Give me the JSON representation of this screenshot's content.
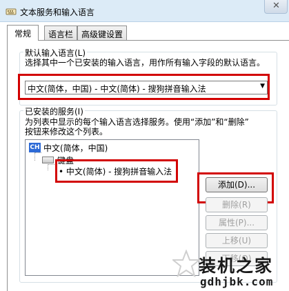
{
  "window": {
    "title": "文本服务和输入语言",
    "close_glyph": "✕"
  },
  "tabs": [
    {
      "label": "常规",
      "active": true
    },
    {
      "label": "语言栏",
      "active": false
    },
    {
      "label": "高级键设置",
      "active": false
    }
  ],
  "default_language": {
    "group_label": "默认输入语言(L)",
    "description": "选择其中一个已安装的输入语言，用作所有输入字段的默认语言。",
    "selected": "中文(简体，中国) - 中文(简体) - 搜狗拼音输入法"
  },
  "installed_services": {
    "group_label": "已安装的服务(I)",
    "description_line1": "为列表中显示的每个输入语言选择服务。使用“添加”和“删除”",
    "description_line2": "按钮来修改这个列表。",
    "tree": {
      "language_badge": "CH",
      "language": "中文(简体，中国)",
      "category": "键盘",
      "item": "• 中文(简体) - 搜狗拼音输入法"
    }
  },
  "buttons": {
    "add": "添加(D)...",
    "remove": "删除(R)",
    "properties": "属性(P)...",
    "move_up": "上移(U)",
    "move_down": "下移(O)"
  },
  "watermark": {
    "title": "装机之家",
    "url": "gdhjbk.com"
  },
  "colors": {
    "highlight": "#d20000",
    "title_bar": "#dcebf7",
    "badge": "#2d6ad6"
  }
}
